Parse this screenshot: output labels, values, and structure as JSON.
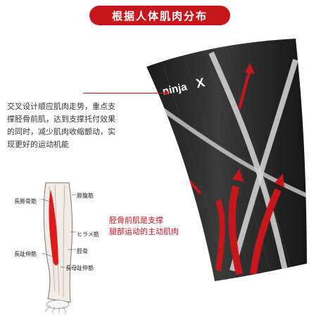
{
  "title": "根据人体肌肉分布",
  "description": [
    "交叉设计顺应肌肉走势，重点支",
    "撑胫骨前肌，达到支撑托付效果",
    "的同时，减少肌肉收缩颤动，实",
    "现更好的运动机能"
  ],
  "brand": "ninjaX",
  "muscle_note": [
    "胫骨前肌是支撑",
    "腿部运动的主动肌肉"
  ],
  "anatomy_labels": {
    "long_peroneal": "長腓骨筋",
    "gastrocnemius": "腓腹筋",
    "soleus": "ヒラメ筋",
    "tibia": "脛骨",
    "extensor_digitorum": "長趾伸筋",
    "extensor_hallucis": "長母趾伸筋"
  },
  "colors": {
    "accent": "#c8161d",
    "sleeve": "#2a2a2a"
  }
}
